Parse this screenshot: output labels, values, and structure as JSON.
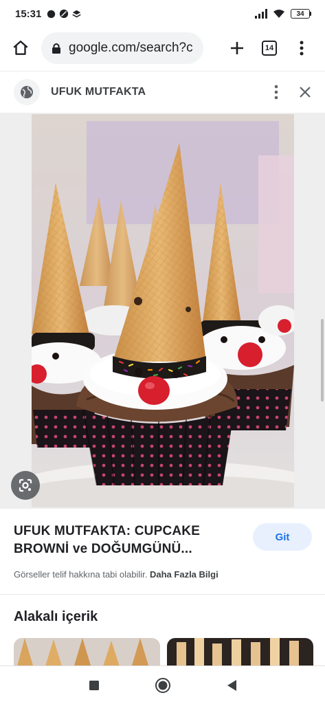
{
  "status_bar": {
    "time": "15:31",
    "left_icons": [
      "whatsapp-icon",
      "moon-icon",
      "app-icon"
    ],
    "right_icons": [
      "signal-icon",
      "wifi-icon"
    ],
    "battery": "34"
  },
  "browser": {
    "url": "google.com/search?c",
    "tab_count": "14"
  },
  "source_header": {
    "site_name": "UFUK MUTFAKTA"
  },
  "result": {
    "title": "UFUK MUTFAKTA: CUPCAKE BROWNİ ve DOĞUMGÜNÜ...",
    "visit_label": "Git",
    "copyright_text": "Görseller telif hakkına tabi olabilir.",
    "more_info_label": "Daha Fazla Bilgi"
  },
  "related": {
    "title": "Alakalı içerik"
  },
  "colors": {
    "accent": "#1a73e8",
    "visit_bg": "#e8f0fe"
  }
}
